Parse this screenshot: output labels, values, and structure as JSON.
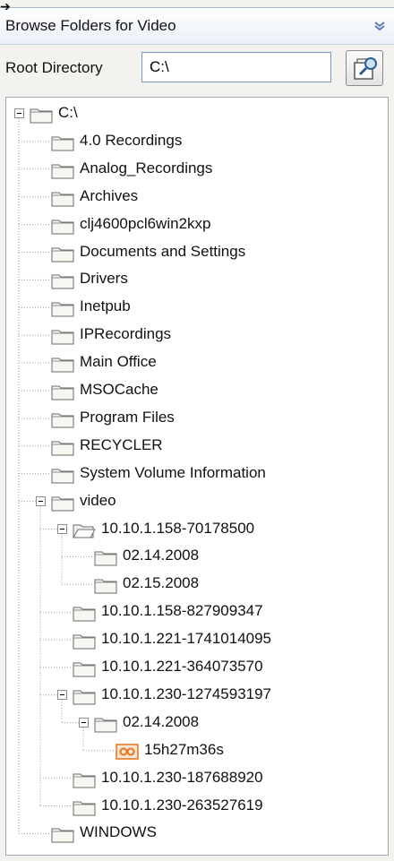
{
  "header": {
    "title": "Browse Folders for Video"
  },
  "root": {
    "label": "Root Directory",
    "value": "C:\\"
  },
  "tree": {
    "rows": [
      {
        "label": "C:\\",
        "icon": "folder-closed",
        "depth": 0,
        "expander": "minus"
      },
      {
        "label": "4.0 Recordings",
        "icon": "folder-closed",
        "depth": 1
      },
      {
        "label": "Analog_Recordings",
        "icon": "folder-closed",
        "depth": 1
      },
      {
        "label": "Archives",
        "icon": "folder-closed",
        "depth": 1
      },
      {
        "label": "clj4600pcl6win2kxp",
        "icon": "folder-closed",
        "depth": 1
      },
      {
        "label": "Documents and Settings",
        "icon": "folder-closed",
        "depth": 1
      },
      {
        "label": "Drivers",
        "icon": "folder-closed",
        "depth": 1
      },
      {
        "label": "Inetpub",
        "icon": "folder-closed",
        "depth": 1
      },
      {
        "label": "IPRecordings",
        "icon": "folder-closed",
        "depth": 1
      },
      {
        "label": "Main Office",
        "icon": "folder-closed",
        "depth": 1
      },
      {
        "label": "MSOCache",
        "icon": "folder-closed",
        "depth": 1
      },
      {
        "label": "Program Files",
        "icon": "folder-closed",
        "depth": 1
      },
      {
        "label": "RECYCLER",
        "icon": "folder-closed",
        "depth": 1
      },
      {
        "label": "System Volume Information",
        "icon": "folder-closed",
        "depth": 1
      },
      {
        "label": "video",
        "icon": "folder-closed",
        "depth": 1,
        "expander": "minus"
      },
      {
        "label": "10.10.1.158-70178500",
        "icon": "folder-open",
        "depth": 2,
        "expander": "minus"
      },
      {
        "label": "02.14.2008",
        "icon": "folder-closed",
        "depth": 3
      },
      {
        "label": "02.15.2008",
        "icon": "folder-closed",
        "depth": 3
      },
      {
        "label": "10.10.1.158-827909347",
        "icon": "folder-closed",
        "depth": 2
      },
      {
        "label": "10.10.1.221-1741014095",
        "icon": "folder-closed",
        "depth": 2
      },
      {
        "label": "10.10.1.221-364073570",
        "icon": "folder-closed",
        "depth": 2
      },
      {
        "label": "10.10.1.230-1274593197",
        "icon": "folder-closed",
        "depth": 2,
        "expander": "minus"
      },
      {
        "label": "02.14.2008",
        "icon": "folder-closed",
        "depth": 3,
        "expander": "minus"
      },
      {
        "label": "15h27m36s",
        "icon": "video-recording",
        "depth": 4
      },
      {
        "label": "10.10.1.230-187688920",
        "icon": "folder-closed",
        "depth": 2
      },
      {
        "label": "10.10.1.230-263527619",
        "icon": "folder-closed",
        "depth": 2
      },
      {
        "label": "WINDOWS",
        "icon": "folder-closed",
        "depth": 1
      }
    ]
  },
  "colors": {
    "header_bg": "#eaf0f7",
    "folder_fill": "#f7f7f2",
    "folder_stroke": "#6b6b6b",
    "video_icon": "#e8731a",
    "tree_lines": "#9a9a9a"
  }
}
